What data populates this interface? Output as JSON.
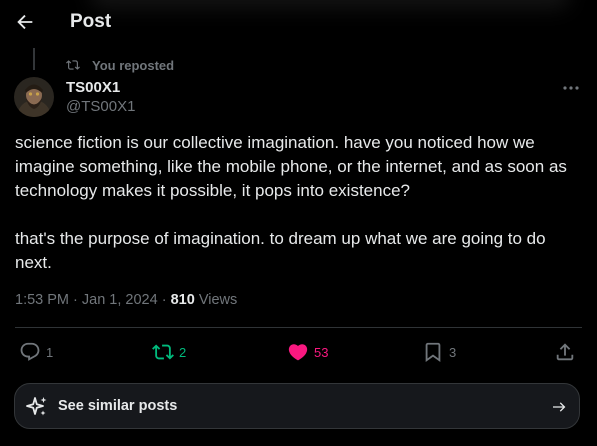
{
  "header": {
    "title": "Post"
  },
  "repost_context": {
    "label": "You reposted"
  },
  "author": {
    "name": "TS00X1",
    "handle": "@TS00X1"
  },
  "post": {
    "text": "science fiction is our collective imagination. have you noticed how we imagine something, like the mobile phone, or the internet, and as soon as technology makes it possible, it pops into existence?\n\nthat's the purpose of imagination. to dream up what we are going to do next.",
    "time": "1:53 PM",
    "date": "Jan 1, 2024",
    "views_count": "810",
    "views_label": "Views"
  },
  "actions": {
    "replies": "1",
    "reposts": "2",
    "likes": "53",
    "bookmarks": "3"
  },
  "similar": {
    "label": "See similar posts"
  },
  "colors": {
    "background": "#000000",
    "text": "#e7e9ea",
    "secondary": "#71767b",
    "repost_green": "#00ba7c",
    "like_pink": "#f91880",
    "border": "#2f3336"
  },
  "icons": [
    "back-arrow-icon",
    "repost-icon",
    "more-icon",
    "reply-icon",
    "heart-icon",
    "bookmark-icon",
    "share-icon",
    "sparkle-icon",
    "arrow-right-icon"
  ]
}
